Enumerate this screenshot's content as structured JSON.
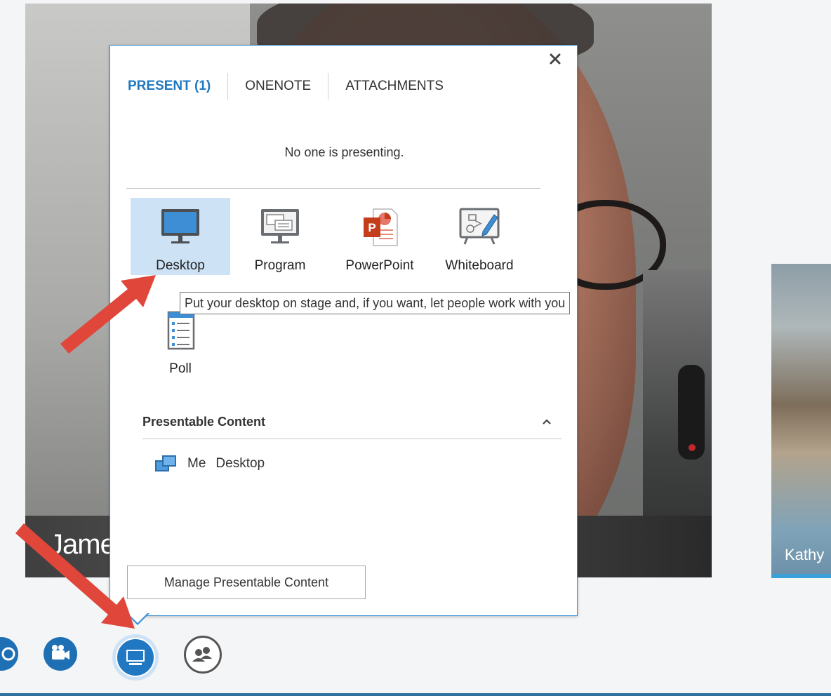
{
  "videos": {
    "main_name": "Jame",
    "side_name": "Kathy"
  },
  "popup": {
    "tabs": [
      {
        "label": "PRESENT (1)",
        "active": true
      },
      {
        "label": "ONENOTE",
        "active": false
      },
      {
        "label": "ATTACHMENTS",
        "active": false
      }
    ],
    "status": "No one is presenting.",
    "options": [
      {
        "label": "Desktop",
        "icon": "desktop-monitor-icon",
        "selected": true
      },
      {
        "label": "Program",
        "icon": "program-window-icon",
        "selected": false
      },
      {
        "label": "PowerPoint",
        "icon": "powerpoint-icon",
        "selected": false
      },
      {
        "label": "Whiteboard",
        "icon": "whiteboard-icon",
        "selected": false
      },
      {
        "label": "Poll",
        "icon": "poll-list-icon",
        "selected": false
      }
    ],
    "presentable": {
      "title": "Presentable Content",
      "items": [
        {
          "owner": "Me",
          "item": "Desktop",
          "icon": "shared-desktop-icon"
        }
      ]
    },
    "manage_label": "Manage Presentable Content",
    "close_icon": "close-icon"
  },
  "tooltip": "Put your desktop on stage and, if you want, let people work with you",
  "toolbar": {
    "buttons": [
      {
        "icon": "dialpad-icon"
      },
      {
        "icon": "video-camera-icon"
      },
      {
        "icon": "present-screen-icon",
        "active": true
      },
      {
        "icon": "participants-icon"
      }
    ]
  },
  "colors": {
    "accent": "#1f78c1",
    "popup_border": "#3b8ed1",
    "selected_bg": "#cde3f5",
    "arrow": "#e0463a"
  }
}
